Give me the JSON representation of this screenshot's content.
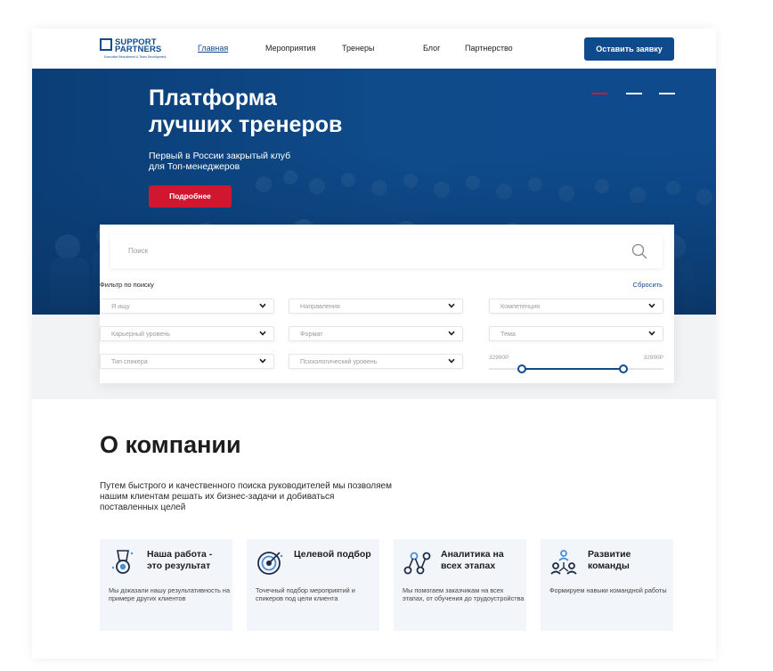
{
  "header": {
    "logo_line1": "SUPPORT",
    "logo_line2": "PARTNERS",
    "logo_tagline": "Executive Recruitment & Team Development",
    "nav": [
      "Главная",
      "Мероприятия",
      "Тренеры",
      "Блог",
      "Партнерство"
    ],
    "active_nav": "Главная",
    "apply_button": "Оставить заявку"
  },
  "hero": {
    "title_line1": "Платформа",
    "title_line2": "лучших тренеров",
    "subtitle_line1": "Первый в России закрытый клуб",
    "subtitle_line2": "для Топ-менеджеров",
    "more_button": "Подробнее",
    "slides_total": 3,
    "slide_active": 1
  },
  "search": {
    "placeholder": "Поиск",
    "filter_title": "Фильтр по поиску",
    "reset_label": "Сбросить",
    "filters": [
      "Я ищу",
      "Направления",
      "Компетенция",
      "Карьерный уровень",
      "Формат",
      "Тема",
      "Тип спикера",
      "Психологический уровень"
    ],
    "price_min_label": "32990Р",
    "price_max_label": "32990Р",
    "price_range_fraction": [
      0.19,
      0.77
    ]
  },
  "about": {
    "title": "О компании",
    "description": "Путем быстрого и качественного поиска руководителей мы позволяем нашим клиентам решать их бизнес-задачи и добиваться поставленных целей",
    "features": [
      {
        "title": "Наша работа - это результат",
        "desc": "Мы доказали нашу результативность на примере других клиентов",
        "icon": "medal-icon"
      },
      {
        "title": "Целевой подбор",
        "desc": "Точечный подбор мероприятий и спикеров под цели клиента",
        "icon": "target-icon"
      },
      {
        "title": "Аналитика на всех этапах",
        "desc": "Мы помогаем заказчикам на всех этапах, от обучения до трудоустройства",
        "icon": "analytics-icon"
      },
      {
        "title": "Развитие команды",
        "desc": "Формируем навыки командной работы",
        "icon": "team-icon"
      }
    ]
  },
  "colors": {
    "brand_blue": "#0e4a8c",
    "accent_red": "#d1172f"
  }
}
